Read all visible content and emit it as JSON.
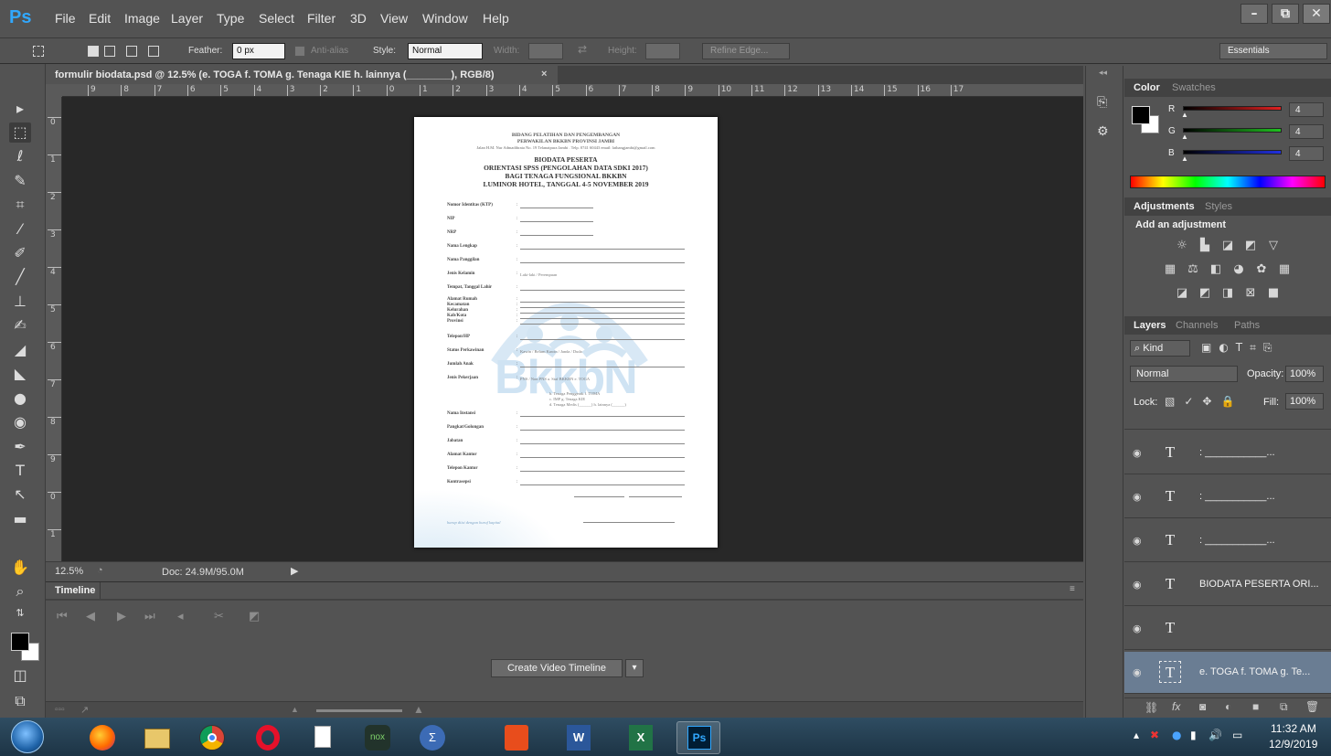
{
  "app": {
    "logo": "Ps",
    "menu": [
      "File",
      "Edit",
      "Image",
      "Layer",
      "Type",
      "Select",
      "Filter",
      "3D",
      "View",
      "Window",
      "Help"
    ],
    "window_controls": [
      "–",
      "⧉",
      "✕"
    ]
  },
  "options": {
    "feather_label": "Feather:",
    "feather_value": "0 px",
    "antialias_label": "Anti-alias",
    "style_label": "Style:",
    "style_value": "Normal",
    "width_label": "Width:",
    "height_label": "Height:",
    "refine_edge": "Refine Edge...",
    "workspace": "Essentials"
  },
  "document": {
    "tab_title": "formulir biodata.psd @ 12.5% (e. TOGA f. TOMA g. Tenaga KIE h. lainnya (________), RGB/8)",
    "tab_close": "×",
    "ruler_top": [
      "9",
      "8",
      "7",
      "6",
      "5",
      "4",
      "3",
      "2",
      "1",
      "0",
      "1",
      "2",
      "3",
      "4",
      "5",
      "6",
      "7",
      "8",
      "9",
      "10",
      "11",
      "12",
      "13",
      "14",
      "15",
      "16",
      "17"
    ],
    "ruler_left": [
      "0",
      "1",
      "2",
      "3",
      "4",
      "5",
      "6",
      "7",
      "8",
      "9",
      "0",
      "1"
    ],
    "zoom": "12.5%",
    "doc_info": "Doc: 24.9M/95.0M"
  },
  "page": {
    "header1": "BIDANG PELATIHAN DAN PENGEMBANGAN",
    "header2": "PERWAKILAN BKKBN PROVINSI JAMBI",
    "address": "Jalan H.M. Nur Admadibrata No. 19 Telanaipura Jambi . Telp. 0741 60443 email: latbangjambi@gmail.com",
    "title1": "BIODATA PESERTA",
    "title2": "ORIENTASI SPSS (PENGOLAHAN DATA SDKI 2017)",
    "title3": "BAGI TENAGA FUNGSIONAL BKKBN",
    "title4": "LUMINOR HOTEL, TANGGAL 4-5 NOVEMBER 2019",
    "watermark": "BkkbN",
    "fields": [
      {
        "label": "Nomor Identitas (KTP)",
        "note": ""
      },
      {
        "label": "NIP",
        "note": ""
      },
      {
        "label": "NRP",
        "note": ""
      },
      {
        "label": "Nama Lengkap",
        "note": ""
      },
      {
        "label": "Nama Panggilan",
        "note": ""
      },
      {
        "label": "Jenis Kelamin",
        "note": "Laki-laki / Perempuan"
      },
      {
        "label": "Tempat, Tanggal Lahir",
        "note": ""
      },
      {
        "label": "Alamat Rumah",
        "note": ""
      },
      {
        "label": "Kecamatan",
        "note": ""
      },
      {
        "label": "Kelurahan",
        "note": ""
      },
      {
        "label": "Kab/Kota",
        "note": ""
      },
      {
        "label": "Provinsi",
        "note": ""
      },
      {
        "label": "Telepon/HP",
        "note": ""
      },
      {
        "label": "Status Perkawinan",
        "note": "Kawin / Belum Kawin / Janda / Duda"
      },
      {
        "label": "Jumlah Anak",
        "note": ""
      },
      {
        "label": "Jenis Pekerjaan",
        "note": "PNS / Non PNS   a. Staf BKKBN              e. TOGA"
      },
      {
        "label": "Nama Instansi",
        "note": ""
      },
      {
        "label": "Pangkat/Golongan",
        "note": ""
      },
      {
        "label": "Jabatan",
        "note": ""
      },
      {
        "label": "Alamat Kantor",
        "note": ""
      },
      {
        "label": "Telepon Kantor",
        "note": ""
      },
      {
        "label": "Kontrasepsi",
        "note": ""
      }
    ],
    "job_options": [
      "b. Tenaga Penggerak        f. TOMA",
      "c. IMP                              g. Tenaga KIE",
      "d. Tenaga Medis (______)   h. lainnya (______)"
    ],
    "footer_note": "harap diisi dengan huruf kapital"
  },
  "timeline": {
    "tab": "Timeline",
    "create_button": "Create Video Timeline",
    "dropdown": "▾"
  },
  "color_panel": {
    "tabs": [
      "Color",
      "Swatches"
    ],
    "channels": [
      {
        "name": "R",
        "value": "4",
        "color": "#e02020"
      },
      {
        "name": "G",
        "value": "4",
        "color": "#20c020"
      },
      {
        "name": "B",
        "value": "4",
        "color": "#2030e0"
      }
    ]
  },
  "adjustments_panel": {
    "tabs": [
      "Adjustments",
      "Styles"
    ],
    "heading": "Add an adjustment"
  },
  "layers_panel": {
    "tabs": [
      "Layers",
      "Channels",
      "Paths"
    ],
    "kind_label": "Kind",
    "blend_mode": "Normal",
    "opacity_label": "Opacity:",
    "opacity_value": "100%",
    "lock_label": "Lock:",
    "fill_label": "Fill:",
    "fill_value": "100%",
    "layers": [
      {
        "name": ": ___________...",
        "selected": false
      },
      {
        "name": ": ___________...",
        "selected": false
      },
      {
        "name": ": ___________...",
        "selected": false
      },
      {
        "name": "BIODATA PESERTA ORI...",
        "selected": false
      },
      {
        "name": "",
        "selected": false
      },
      {
        "name": "e. TOGA f. TOMA g. Te...",
        "selected": true
      }
    ]
  },
  "taskbar": {
    "clock_time": "11:32 AM",
    "clock_date": "12/9/2019",
    "apps": [
      "firefox",
      "file-explorer",
      "chrome",
      "opera",
      "document",
      "nox",
      "sigma",
      "app-orange",
      "word",
      "excel",
      "photoshop"
    ],
    "ps_label": "Ps"
  }
}
